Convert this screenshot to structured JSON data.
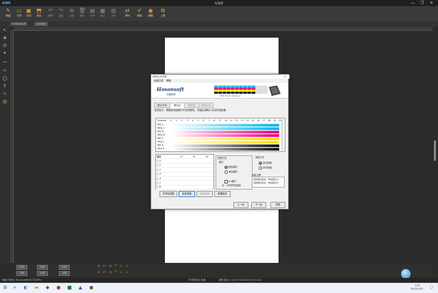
{
  "app": {
    "logo": "ANN",
    "title": "标准版",
    "window_controls": [
      "—",
      "❐",
      "✕"
    ]
  },
  "toolbar": {
    "items": [
      {
        "label": "新建",
        "icon": "new-icon"
      },
      {
        "label": "打开",
        "icon": "open-icon"
      },
      {
        "label": "打印",
        "icon": "print-icon"
      },
      {
        "label": "导出",
        "icon": "export-icon"
      },
      {
        "label": "撤销",
        "icon": "undo-icon"
      },
      {
        "label": "重做",
        "icon": "redo-icon"
      },
      {
        "label": "复制",
        "icon": "copy-icon"
      },
      {
        "label": "删除",
        "icon": "delete-icon"
      },
      {
        "label": "对齐",
        "icon": "align-icon"
      },
      {
        "label": "组合",
        "icon": "group-icon"
      },
      {
        "label": "分布",
        "icon": "distribute-icon"
      },
      {
        "label": "排列",
        "icon": "arrange-icon"
      },
      {
        "label": "颜色",
        "icon": "color-icon"
      },
      {
        "label": "视图",
        "icon": "view-icon"
      },
      {
        "label": "工具",
        "icon": "tools-icon"
      }
    ]
  },
  "tabs": [
    "打印校准向导",
    "untitled"
  ],
  "dialog": {
    "title": "颜色比对向导",
    "menu": [
      "选择文件",
      "帮助"
    ],
    "brand": "Hosonsoft",
    "brand_sub": "汉森软件",
    "strip_caption": "BMP Vertex Manager",
    "tabs": [
      "喷头分析",
      "调色法",
      "喷墨量",
      "颜色比对"
    ],
    "instruction": "当前显示：根据检测结果打印出的颜色，测量后请输入对应的测量值",
    "channel_header": "Channel",
    "channel_numbers": [
      "0",
      "1",
      "2",
      "3",
      "4",
      "5",
      "6",
      "7",
      "8",
      "9",
      "10",
      "11",
      "12",
      "13",
      "14",
      "15",
      "16",
      "17",
      "18",
      "19",
      "20"
    ],
    "channels": [
      {
        "label": "Ref_C",
        "color": "#00b7eb"
      },
      {
        "label": "Mea_C",
        "color": "#00b7eb"
      },
      {
        "label": "Ref_M",
        "color": "#e8007a"
      },
      {
        "label": "Mea_M",
        "color": "#e8007a"
      },
      {
        "label": "Ref_Y",
        "color": "#ffe000"
      },
      {
        "label": "Mea_Y",
        "color": "#ffe000"
      },
      {
        "label": "Ref_K",
        "color": "#111111"
      },
      {
        "label": "Mea_K",
        "color": "#111111"
      }
    ],
    "result_table": {
      "headers": [
        "通道",
        "L*",
        "a*",
        "b*"
      ],
      "rows": [
        "C_0",
        "C_1",
        "C_2",
        "C_3",
        "C_4",
        "C_5",
        "C_6"
      ]
    },
    "measure_mode": {
      "title": "检查方式",
      "subtitle": "模式",
      "options": [
        "检查模式",
        "添加模式"
      ],
      "selected": 0
    },
    "measure_device": {
      "title": "测量方式",
      "options": [
        "自动测量",
        "手动测量"
      ],
      "selected": 0
    },
    "uv_checkbox": "UV窗口",
    "uv_note": "注：UV时同时选择",
    "position_box": {
      "title": "测量位置",
      "lines": [
        "位置坐标(起点)：纵向起点(X)",
        "位置坐标(终点)：纵向起点(X)"
      ]
    },
    "action_buttons": [
      "打印检查图",
      "检查测量",
      "检查结果",
      "数据保存"
    ],
    "nav_buttons": [
      "上一步",
      "下一步",
      "完成"
    ]
  },
  "bottom": {
    "fields": [
      "0.00",
      "0.00",
      "0.00",
      "0.00",
      "0.00",
      "0.00"
    ],
    "status_left": "就绪 打印机: HosonsoftUV6-2500Pro",
    "status_mid": "打印机状态: 就绪",
    "status_right": "图形坐标: X:0.00 Y:0.00 W:0.00 H:0.00"
  },
  "taskbar": {
    "time": "1:07",
    "date": "2022/1/24"
  }
}
